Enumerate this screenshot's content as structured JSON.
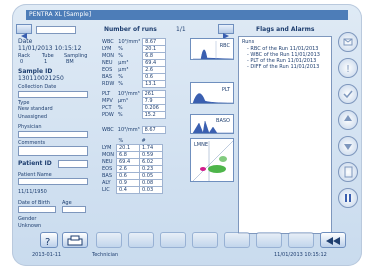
{
  "window": {
    "title": "PENTRA XL  [Sample]"
  },
  "sample": {
    "date_label": "Date",
    "date_value": "11/01/2013 10:15:12",
    "rack_label": "Rack",
    "tube_label": "Tube",
    "sampling_label": "Sampling",
    "rack_value": "0",
    "tube_value": "1",
    "sampling_value": "BM",
    "sample_id_label": "Sample ID",
    "sample_id_value": "130110021250",
    "collection_label": "Collection Date",
    "type_label": "Type",
    "type_value": "New standard",
    "unit_value": "Unassigned",
    "physician_label": "Physician",
    "comments_label": "Comments",
    "patient_id_label": "Patient ID",
    "patient_name_label": "Patient Name",
    "birth_value": "11/11/1950",
    "date_of_birth_label": "Date of Birth",
    "age_label": "Age",
    "gender_label": "Gender",
    "gender_value": "Unknown"
  },
  "params": {
    "header_label": "Number of runs",
    "header_value": "1/1",
    "wbc_group": [
      {
        "name": "WBC",
        "unit": "10³/mm³",
        "value": "8.67"
      },
      {
        "name": "LYM",
        "unit": "%",
        "value": "20.1"
      },
      {
        "name": "MON",
        "unit": "%",
        "value": "6.8"
      },
      {
        "name": "NEU",
        "unit": "μm³",
        "value": "69.4"
      },
      {
        "name": "EOS",
        "unit": "μm³",
        "value": "2.6"
      },
      {
        "name": "BAS",
        "unit": "%",
        "value": "0.6"
      },
      {
        "name": "RDW",
        "unit": "%",
        "value": "13.1"
      }
    ],
    "rbc_group": [
      {
        "name": "PLT",
        "unit": "10³/mm³",
        "value": "261"
      },
      {
        "name": "MPV",
        "unit": "μm³",
        "value": "7.9"
      },
      {
        "name": "PCT",
        "unit": "%",
        "value": "0.206"
      },
      {
        "name": "PDW",
        "unit": "%",
        "value": "15.2"
      }
    ],
    "wbc_diff_header": {
      "name": "WBC",
      "unit": "10³/mm³",
      "value": "8.67"
    },
    "diff_cols": [
      "%",
      "#"
    ],
    "diff_group": [
      {
        "name": "LYM",
        "pct": "20.1",
        "abs": "1.74"
      },
      {
        "name": "MON",
        "pct": "6.8",
        "abs": "0.59"
      },
      {
        "name": "NEU",
        "pct": "69.4",
        "abs": "6.02"
      },
      {
        "name": "EOS",
        "pct": "2.6",
        "abs": "0.23"
      },
      {
        "name": "BAS",
        "pct": "0.6",
        "abs": "0.05"
      },
      {
        "name": "ALY",
        "pct": "0.9",
        "abs": "0.08"
      },
      {
        "name": "LIC",
        "pct": "0.4",
        "abs": "0.03"
      }
    ],
    "plot_labels": [
      "RBC",
      "PLT",
      "BASO",
      "LMNE"
    ]
  },
  "flags": {
    "header": "Flags and Alarms",
    "root": "Runs",
    "items": [
      "RBC of the Run 11/01/2013",
      "WBC of the Run 11/01/2013",
      "PLT of the Run 11/01/2013",
      "DIFF of the Run 11/01/2013"
    ]
  },
  "status": {
    "left": "2013-01-11",
    "middle": "Technician",
    "right": "11/01/2013 10:15:12"
  },
  "colors": {
    "accent": "#4d7db8",
    "panel": "#c9dbee",
    "histogram": "#3a5fb0",
    "scatter_green": "#2fa82a"
  },
  "icons": {
    "help": "question-icon",
    "print": "printer-icon",
    "validate": "checkmark-icon",
    "warning": "exclamation-icon",
    "report": "document-icon",
    "back": "rewind-icon"
  }
}
